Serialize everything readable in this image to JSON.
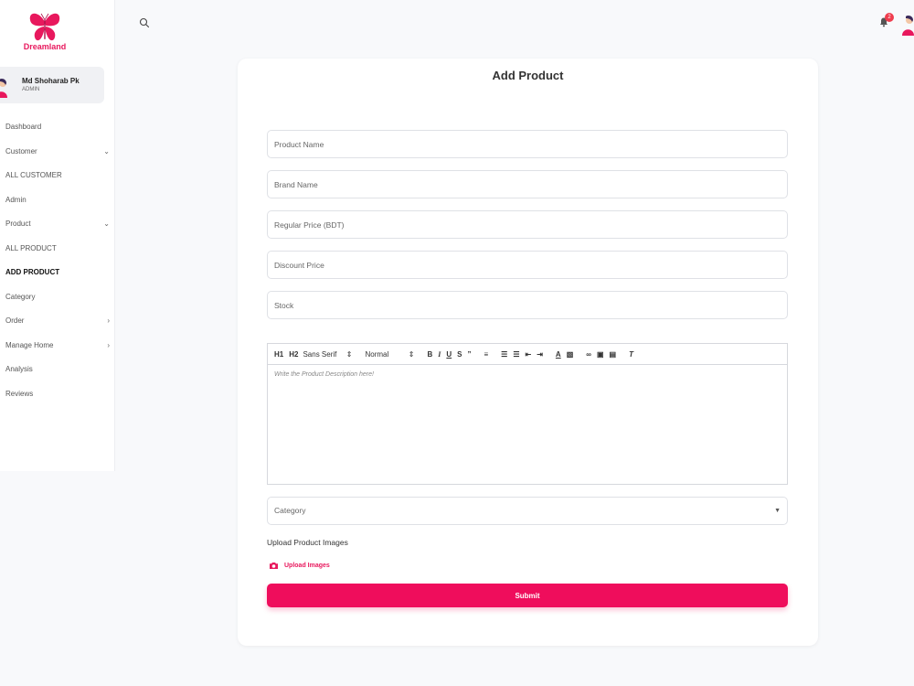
{
  "brand": {
    "name": "Dreamland",
    "color": "#e8185d"
  },
  "user": {
    "name": "Md Shoharab Pk",
    "role": "ADMIN"
  },
  "header": {
    "notification_count": "2",
    "search_icon": "search-icon",
    "bell_icon": "bell-icon"
  },
  "sidebar": {
    "items": [
      {
        "label": "Dashboard",
        "chevron": ""
      },
      {
        "label": "Customer",
        "chevron": "⌄"
      },
      {
        "label": "ALL CUSTOMER",
        "chevron": ""
      },
      {
        "label": "Admin",
        "chevron": ""
      },
      {
        "label": "Product",
        "chevron": "⌄"
      },
      {
        "label": "ALL PRODUCT",
        "chevron": ""
      },
      {
        "label": "ADD PRODUCT",
        "chevron": "",
        "active": true
      },
      {
        "label": "Category",
        "chevron": ""
      },
      {
        "label": "Order",
        "chevron": "›"
      },
      {
        "label": "Manage Home",
        "chevron": "›"
      },
      {
        "label": "Analysis",
        "chevron": ""
      },
      {
        "label": "Reviews",
        "chevron": ""
      }
    ]
  },
  "form": {
    "title": "Add Product",
    "product_name_placeholder": "Product Name",
    "brand_name_placeholder": "Brand Name",
    "regular_price_placeholder": "Regular Price (BDT)",
    "discount_price_placeholder": "Discount Price",
    "stock_placeholder": "Stock",
    "editor": {
      "h1": "H1",
      "h2": "H2",
      "font": "Sans Serif",
      "size": "Normal",
      "placeholder": "Write the Product Description here!"
    },
    "category_placeholder": "Category",
    "upload_label": "Upload Product Images",
    "upload_button": "Upload Images",
    "submit_label": "Submit"
  },
  "colors": {
    "accent": "#ef0d5c",
    "badge": "#ef3c4d"
  }
}
